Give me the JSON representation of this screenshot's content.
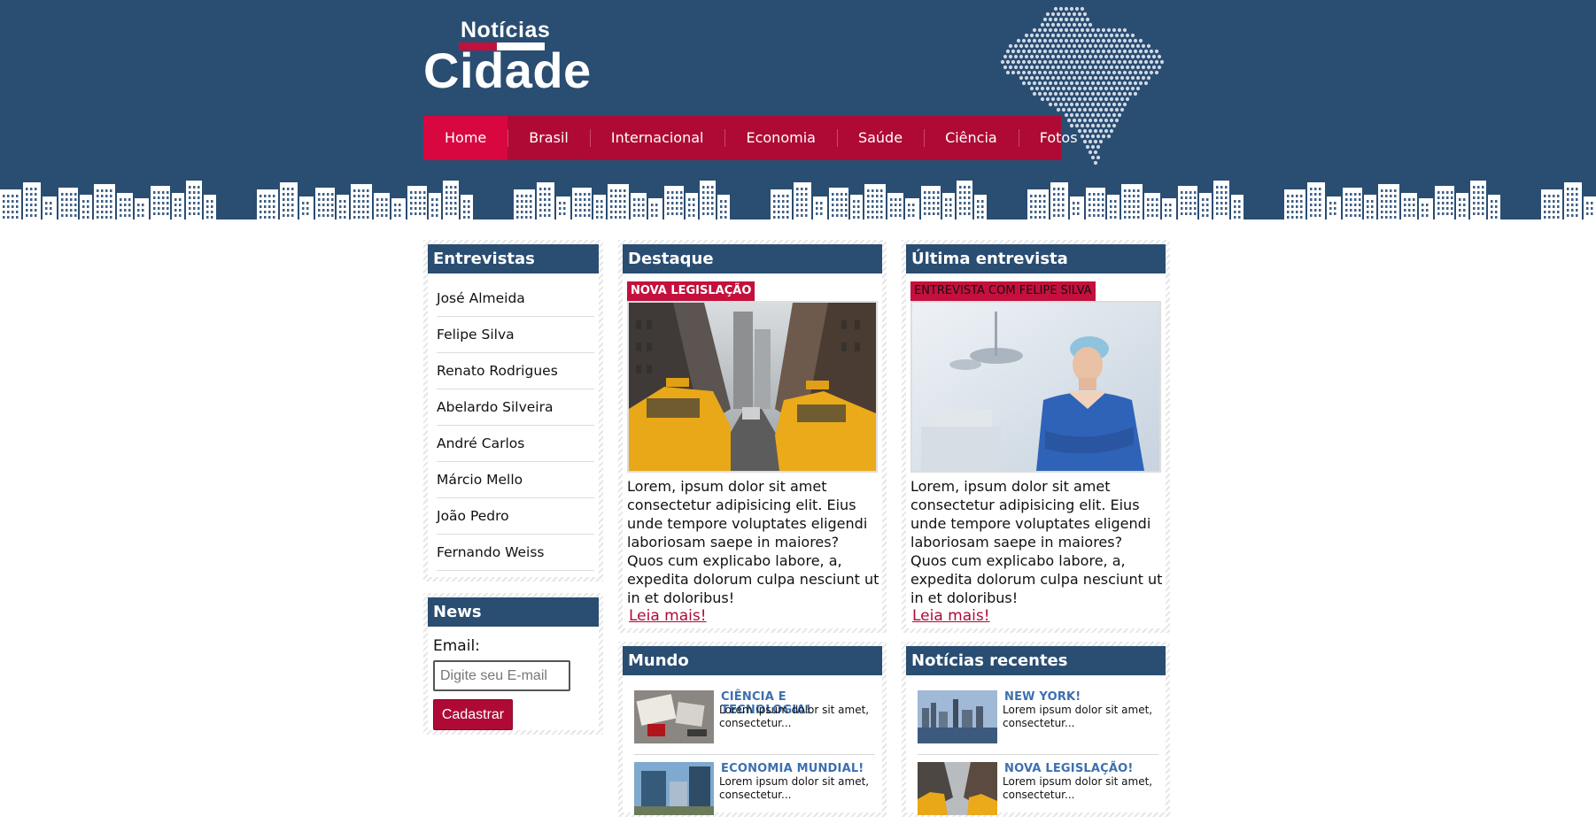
{
  "brand": {
    "top_word": "Notícias",
    "main_word": "Cidade"
  },
  "nav": {
    "items": [
      {
        "label": "Home",
        "active": true
      },
      {
        "label": "Brasil"
      },
      {
        "label": "Internacional"
      },
      {
        "label": "Economia"
      },
      {
        "label": "Saúde"
      },
      {
        "label": "Ciência"
      },
      {
        "label": "Fotos"
      }
    ]
  },
  "sidebar": {
    "entrevistas_title": "Entrevistas",
    "entrevistas": [
      "José Almeida",
      "Felipe Silva",
      "Renato Rodrigues",
      "Abelardo Silveira",
      "André Carlos",
      "Márcio Mello",
      "João Pedro",
      "Fernando Weiss"
    ],
    "news_title": "News",
    "email_label": "Email:",
    "email_placeholder": "Digite seu E-mail",
    "submit_label": "Cadastrar"
  },
  "destaque": {
    "title": "Destaque",
    "tag": "NOVA LEGISLAÇÃO",
    "tag_text_color": "#ffffff",
    "text": "Lorem, ipsum dolor sit amet consectetur adipisicing elit. Eius unde tempore voluptates eligendi laboriosam saepe in maiores? Quos cum explicabo labore, a, expedita dolorum culpa nesciunt ut in et doloribus!",
    "read_more": "Leia mais!"
  },
  "ultima": {
    "title": "Última entrevista",
    "tag": "ENTREVISTA COM FELIPE SILVA",
    "tag_text_color": "#111111",
    "text": "Lorem, ipsum dolor sit amet consectetur adipisicing elit. Eius unde tempore voluptates eligendi laboriosam saepe in maiores? Quos cum explicabo labore, a, expedita dolorum culpa nesciunt ut in et doloribus!",
    "read_more": "Leia mais!"
  },
  "mundo": {
    "title": "Mundo",
    "items": [
      {
        "title": "CIÊNCIA E TECNOLOGIA!",
        "text": "Lorem ipsum dolor sit amet, consectetur..."
      },
      {
        "title": "ECONOMIA MUNDIAL!",
        "text": "Lorem ipsum dolor sit amet, consectetur..."
      }
    ]
  },
  "recentes": {
    "title": "Notícias recentes",
    "items": [
      {
        "title": "NEW YORK!",
        "text": "Lorem ipsum dolor sit amet, consectetur..."
      },
      {
        "title": "NOVA LEGISLAÇÃO!",
        "text": "Lorem ipsum dolor sit amet, consectetur..."
      }
    ]
  },
  "colors": {
    "header_bg": "#2a4d72",
    "nav_bg": "#af0a35",
    "nav_active": "#d8073f",
    "accent_red": "#c4103d",
    "link_blue": "#3d6fb0"
  }
}
